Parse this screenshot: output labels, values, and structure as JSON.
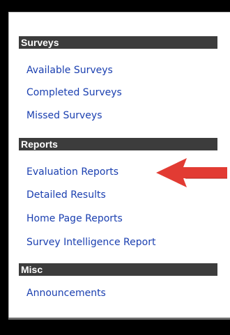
{
  "sections": [
    {
      "title": "Surveys",
      "links": [
        "Available Surveys",
        "Completed Surveys",
        "Missed Surveys"
      ]
    },
    {
      "title": "Reports",
      "links": [
        "Evaluation Reports",
        "Detailed Results",
        "Home Page Reports",
        "Survey Intelligence Report"
      ]
    },
    {
      "title": "Misc",
      "links": [
        "Announcements"
      ]
    }
  ],
  "colors": {
    "header_bg": "#3c3c3c",
    "link": "#1a3fb0",
    "arrow": "#e23b33"
  },
  "icons": {
    "annotation": "red-arrow-icon"
  }
}
